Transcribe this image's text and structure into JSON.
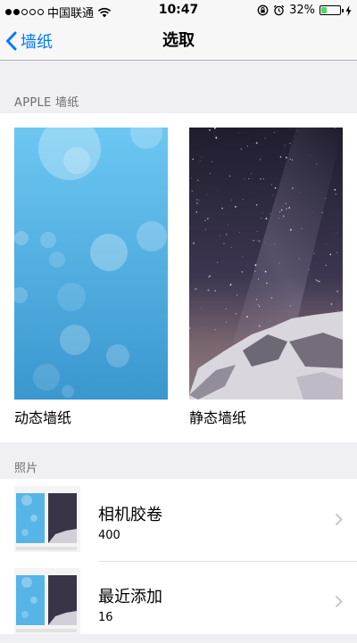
{
  "status": {
    "carrier": "中国联通",
    "time": "10:47",
    "battery": "32%",
    "battery_level": 0.32,
    "signal_filled": 2,
    "signal_total": 5
  },
  "nav": {
    "back_label": "墙纸",
    "title": "选取"
  },
  "apple_section": {
    "header": "APPLE 墙纸",
    "items": [
      {
        "label": "动态墙纸",
        "kind": "dynamic"
      },
      {
        "label": "静态墙纸",
        "kind": "still"
      }
    ]
  },
  "photos_section": {
    "header": "照片",
    "albums": [
      {
        "name": "相机胶卷",
        "count": "400"
      },
      {
        "name": "最近添加",
        "count": "16"
      }
    ]
  },
  "colors": {
    "accent": "#007aff",
    "battery_green": "#4cd964",
    "background": "#efeff4"
  }
}
